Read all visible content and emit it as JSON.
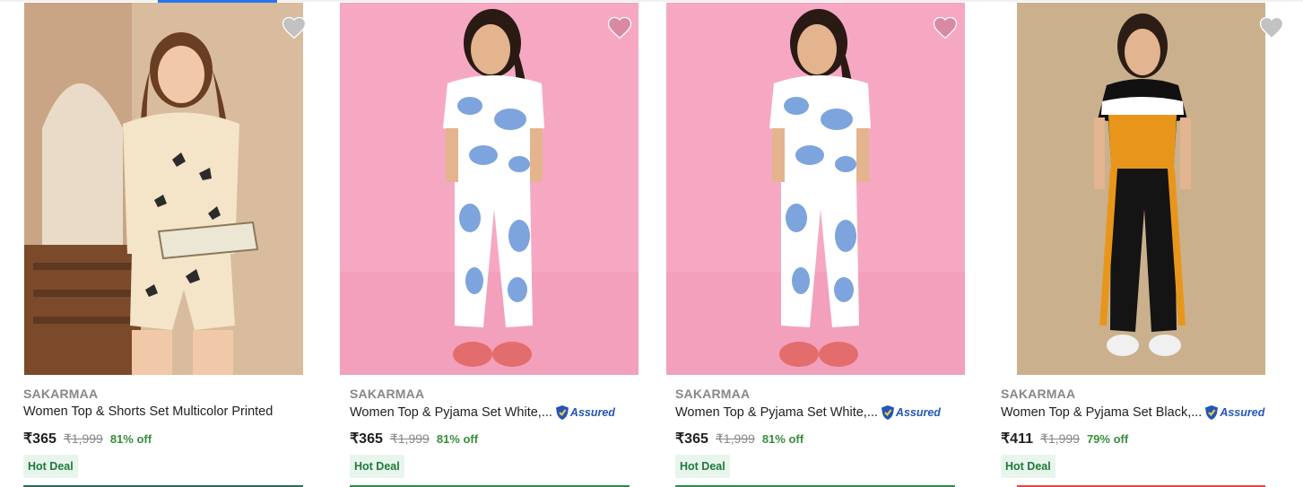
{
  "products": [
    {
      "brand": "SAKARMAA",
      "title": "Women Top & Shorts Set Multicolor Printed",
      "assured": false,
      "price": "₹365",
      "mrp": "₹1,999",
      "discount": "81% off",
      "badge": "Hot Deal",
      "wishlist_icon": "heart-icon",
      "image_bg": "#d8b89a"
    },
    {
      "brand": "SAKARMAA",
      "title": "Women Top & Pyjama Set White,...",
      "assured": true,
      "assured_label": "Assured",
      "price": "₹365",
      "mrp": "₹1,999",
      "discount": "81% off",
      "badge": "Hot Deal",
      "wishlist_icon": "heart-icon",
      "image_bg": "#f5a5c0"
    },
    {
      "brand": "SAKARMAA",
      "title": "Women Top & Pyjama Set White,...",
      "assured": true,
      "assured_label": "Assured",
      "price": "₹365",
      "mrp": "₹1,999",
      "discount": "81% off",
      "badge": "Hot Deal",
      "wishlist_icon": "heart-icon",
      "image_bg": "#f5a5c0"
    },
    {
      "brand": "SAKARMAA",
      "title": "Women Top & Pyjama Set Black,...",
      "assured": true,
      "assured_label": "Assured",
      "price": "₹411",
      "mrp": "₹1,999",
      "discount": "79% off",
      "badge": "Hot Deal",
      "wishlist_icon": "heart-icon",
      "image_bg": "#c9ad8a"
    }
  ],
  "colors": {
    "accent": "#2874f0",
    "discount": "#388e3c",
    "badge_bg": "#e8f5ec",
    "assured": "#2455b8"
  }
}
